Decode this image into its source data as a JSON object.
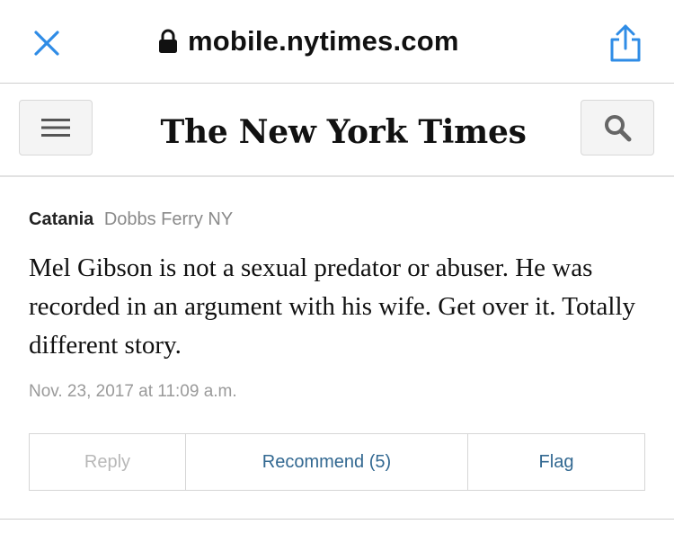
{
  "browser": {
    "url": "mobile.nytimes.com",
    "close_icon": "close-icon",
    "lock_icon": "lock-icon",
    "share_icon": "share-icon",
    "accent_color": "#2f8ce6"
  },
  "header": {
    "logo_text": "The New York Times",
    "menu_icon": "hamburger-menu-icon",
    "search_icon": "search-icon"
  },
  "comment": {
    "author": "Catania",
    "location": "Dobbs Ferry NY",
    "body": "Mel Gibson is not a sexual predator or abuser. He was recorded in an argument with his wife. Get over it. Totally different story.",
    "timestamp": "Nov. 23, 2017 at 11:09 a.m.",
    "actions": {
      "reply": "Reply",
      "recommend": "Recommend (5)",
      "flag": "Flag"
    },
    "link_color": "#326891"
  }
}
